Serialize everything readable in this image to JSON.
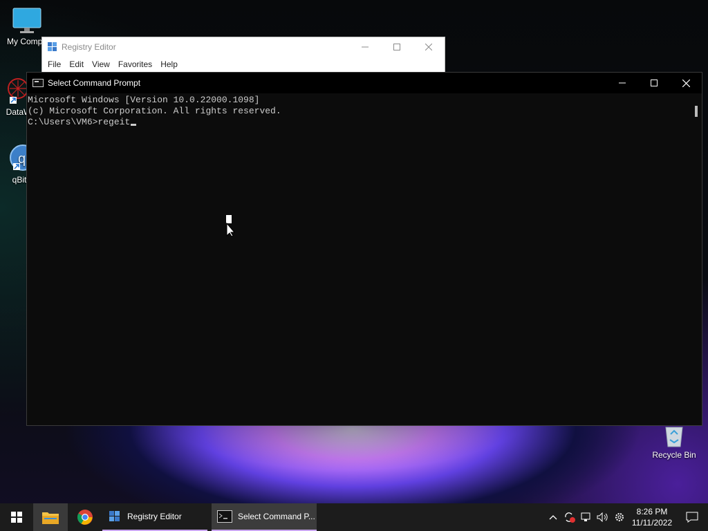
{
  "desktop": {
    "icons": [
      {
        "label": "My Compu",
        "icon": "monitor-icon"
      },
      {
        "label": "DataW",
        "icon": "datawrapper-icon"
      },
      {
        "label": "qBitto",
        "icon": "qbittorrent-icon"
      },
      {
        "label": "Recycle Bin",
        "icon": "recycle-bin-icon"
      }
    ]
  },
  "registry_window": {
    "title": "Registry Editor",
    "menu": [
      "File",
      "Edit",
      "View",
      "Favorites",
      "Help"
    ]
  },
  "cmd_window": {
    "title": "Select Command Prompt",
    "lines": [
      "Microsoft Windows [Version 10.0.22000.1098]",
      "(c) Microsoft Corporation. All rights reserved.",
      "C:\\Users\\VM6>regeit"
    ]
  },
  "taskbar": {
    "apps": [
      {
        "label": "Registry Editor",
        "icon": "registry-editor-icon"
      },
      {
        "label": "Select Command P...",
        "icon": "command-prompt-icon"
      }
    ],
    "clock_time": "8:26 PM",
    "clock_date": "11/11/2022"
  },
  "colors": {
    "cmd_background": "#0c0c0c",
    "cmd_text": "#cccccc",
    "taskbar": "#1c1c1c",
    "accent": "#c9a6f0"
  }
}
